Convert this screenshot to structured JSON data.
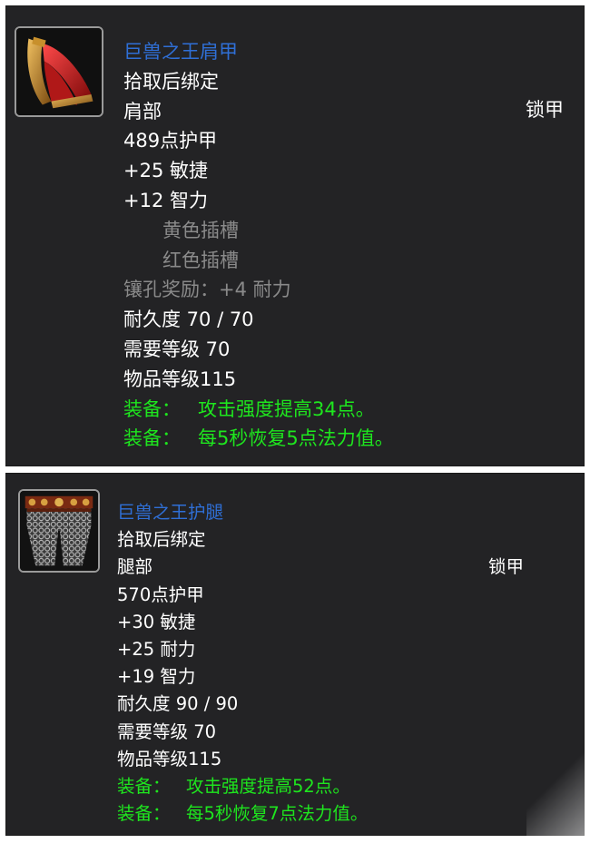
{
  "items": [
    {
      "name": "巨兽之王肩甲",
      "bind": "拾取后绑定",
      "slot": "肩部",
      "armor_type": "锁甲",
      "armor": "489点护甲",
      "stats": [
        "+25 敏捷",
        "+12 智力"
      ],
      "sockets": [
        "黄色插槽",
        "红色插槽"
      ],
      "socket_bonus": "镶孔奖励：+4 耐力",
      "durability": "耐久度 70 / 70",
      "req_level": "需要等级 70",
      "item_level": "物品等级115",
      "equips": [
        {
          "label": "装备：",
          "text": "攻击强度提高34点。"
        },
        {
          "label": "装备：",
          "text": "每5秒恢复5点法力值。"
        }
      ],
      "icon": "shoulder-armor-icon"
    },
    {
      "name": "巨兽之王护腿",
      "bind": "拾取后绑定",
      "slot": "腿部",
      "armor_type": "锁甲",
      "armor": "570点护甲",
      "stats": [
        "+30 敏捷",
        "+25 耐力",
        "+19 智力"
      ],
      "durability": "耐久度 90 / 90",
      "req_level": "需要等级 70",
      "item_level": "物品等级115",
      "equips": [
        {
          "label": "装备：",
          "text": "攻击强度提高52点。"
        },
        {
          "label": "装备：",
          "text": "每5秒恢复7点法力值。"
        }
      ],
      "icon": "leg-armor-icon"
    }
  ],
  "colors": {
    "panel_bg": "#232325",
    "item_name": "#2f6fd6",
    "equip_green": "#1ee61e",
    "socket_gray": "#8a8a8a",
    "text_white": "#ffffff"
  }
}
